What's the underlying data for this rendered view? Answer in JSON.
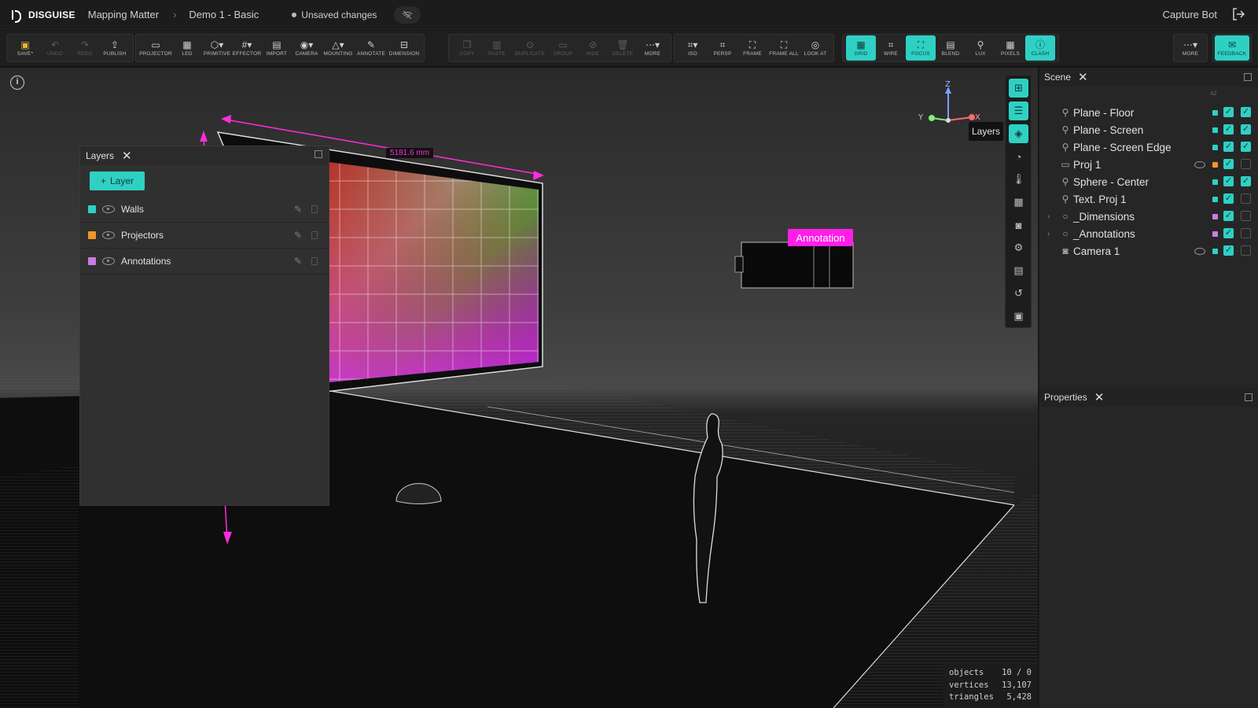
{
  "titlebar": {
    "brand": "DISGUISE",
    "project": "Mapping Matter",
    "separator": "›",
    "document": "Demo 1 - Basic",
    "status": "Unsaved changes",
    "user": "Capture Bot"
  },
  "toolbar": {
    "file": [
      {
        "label": "SAVE*",
        "icon": "save-icon"
      },
      {
        "label": "UNDO",
        "icon": "undo-icon"
      },
      {
        "label": "REDO",
        "icon": "redo-icon"
      },
      {
        "label": "PUBLISH",
        "icon": "publish-icon"
      }
    ],
    "create": [
      {
        "label": "PROJECTOR",
        "icon": "projector-icon"
      },
      {
        "label": "LED",
        "icon": "led-icon"
      },
      {
        "label": "PRIMITIVE",
        "icon": "primitive-icon"
      },
      {
        "label": "EFFECTOR",
        "icon": "effector-icon"
      },
      {
        "label": "IMPORT",
        "icon": "import-icon"
      },
      {
        "label": "CAMERA",
        "icon": "camera-icon"
      },
      {
        "label": "MOUNTING",
        "icon": "mounting-icon"
      },
      {
        "label": "ANNOTATE",
        "icon": "annotate-icon"
      },
      {
        "label": "DIMENSION",
        "icon": "dimension-icon"
      }
    ],
    "edit": [
      {
        "label": "COPY",
        "icon": "copy-icon"
      },
      {
        "label": "PASTE",
        "icon": "paste-icon"
      },
      {
        "label": "DUPLICATE",
        "icon": "duplicate-icon"
      },
      {
        "label": "GROUP",
        "icon": "group-icon"
      },
      {
        "label": "HIDE",
        "icon": "hide-icon"
      },
      {
        "label": "DELETE",
        "icon": "delete-icon"
      },
      {
        "label": "MORE",
        "icon": "more-icon"
      }
    ],
    "view": [
      {
        "label": "ISO",
        "icon": "iso-icon"
      },
      {
        "label": "PERSP",
        "icon": "persp-icon"
      },
      {
        "label": "FRAME",
        "icon": "frame-icon"
      },
      {
        "label": "FRAME ALL",
        "icon": "frame-all-icon"
      },
      {
        "label": "LOOK AT",
        "icon": "look-at-icon"
      }
    ],
    "display": [
      {
        "label": "GRID",
        "icon": "grid-icon",
        "active": true
      },
      {
        "label": "WIRE",
        "icon": "wire-icon",
        "active": false
      },
      {
        "label": "FOCUS",
        "icon": "focus-icon",
        "active": true
      },
      {
        "label": "BLEND",
        "icon": "blend-icon",
        "active": false
      },
      {
        "label": "LUX",
        "icon": "lux-icon",
        "active": false
      },
      {
        "label": "PIXELS",
        "icon": "pixels-icon",
        "active": false
      },
      {
        "label": "CLASH",
        "icon": "clash-icon",
        "active": true
      }
    ],
    "more_label": "MORE",
    "feedback_label": "FEEDBACK"
  },
  "viewport": {
    "dimension_label": "5181.6 mm",
    "annotation_label": "Annotation",
    "axes": {
      "z": "Z",
      "y": "Y",
      "x": "X"
    },
    "stats": [
      {
        "key": "objects",
        "value": "10 / 0"
      },
      {
        "key": "vertices",
        "value": "13,107"
      },
      {
        "key": "triangles",
        "value": "5,428"
      }
    ]
  },
  "layers_panel": {
    "title": "Layers",
    "add_button": "Layer",
    "layers": [
      {
        "name": "Walls",
        "color": "#2fd0c4"
      },
      {
        "name": "Projectors",
        "color": "#f0962a"
      },
      {
        "name": "Annotations",
        "color": "#c77ee0"
      }
    ]
  },
  "rail": {
    "tooltip": "Layers"
  },
  "scene_panel": {
    "title": "Scene",
    "sort_label": "AZ",
    "items": [
      {
        "name": "Plane - Floor",
        "color": "#2fd0c4",
        "eye": false,
        "c1": true,
        "c2": true,
        "expand": false
      },
      {
        "name": "Plane - Screen",
        "color": "#2fd0c4",
        "eye": false,
        "c1": true,
        "c2": true,
        "expand": false
      },
      {
        "name": "Plane - Screen Edge",
        "color": "#2fd0c4",
        "eye": false,
        "c1": true,
        "c2": true,
        "expand": false
      },
      {
        "name": "Proj 1",
        "color": "#f0962a",
        "eye": true,
        "c1": true,
        "c2": false,
        "expand": false
      },
      {
        "name": "Sphere - Center",
        "color": "#2fd0c4",
        "eye": false,
        "c1": true,
        "c2": true,
        "expand": false
      },
      {
        "name": "Text. Proj 1",
        "color": "#2fd0c4",
        "eye": false,
        "c1": true,
        "c2": false,
        "expand": false
      },
      {
        "name": "_Dimensions",
        "color": "#c77ee0",
        "eye": false,
        "c1": true,
        "c2": false,
        "expand": true
      },
      {
        "name": "_Annotations",
        "color": "#c77ee0",
        "eye": false,
        "c1": true,
        "c2": false,
        "expand": true
      },
      {
        "name": "Camera 1",
        "color": "#2fd0c4",
        "eye": true,
        "c1": true,
        "c2": false,
        "expand": false
      }
    ]
  },
  "properties_panel": {
    "title": "Properties"
  }
}
